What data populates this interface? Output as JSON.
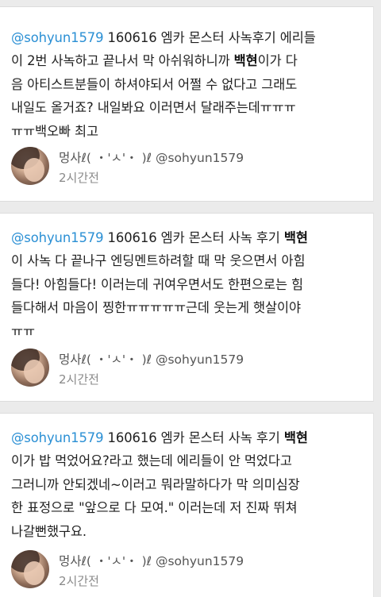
{
  "tweets": [
    {
      "lines": [
        {
          "parts": [
            {
              "t": "@sohyun1579",
              "s": "mention"
            },
            {
              "t": " 160616 엠카 몬스터 사녹후기 에리들",
              "s": "text"
            }
          ]
        },
        {
          "parts": [
            {
              "t": "이 2번 사녹하고 끝나서 막 아쉬워하니까 ",
              "s": "text"
            },
            {
              "t": "백현",
              "s": "bold"
            },
            {
              "t": "이가 다",
              "s": "text"
            }
          ]
        },
        {
          "parts": [
            {
              "t": "음 아티스트분들이 하셔야되서 어쩔 수 없다고 그래도",
              "s": "text"
            }
          ]
        },
        {
          "parts": [
            {
              "t": "내일도 올거죠? 내일봐요 이러면서 달래주는데ㅠㅠㅠ",
              "s": "text"
            }
          ]
        },
        {
          "parts": [
            {
              "t": "ㅠㅠ백오빠 최고",
              "s": "text"
            }
          ]
        }
      ],
      "user": "멍사ℓ( ・'ㅅ'・ )ℓ @sohyun1579",
      "time": "2시간전"
    },
    {
      "lines": [
        {
          "parts": [
            {
              "t": "@sohyun1579",
              "s": "mention"
            },
            {
              "t": " 160616 엠카 몬스터 사녹 후기 ",
              "s": "text"
            },
            {
              "t": "백현",
              "s": "bold"
            }
          ]
        },
        {
          "parts": [
            {
              "t": "이 사녹 다 끝나구 엔딩멘트하려할 때 막 웃으면서 아힘",
              "s": "text"
            }
          ]
        },
        {
          "parts": [
            {
              "t": "들다! 아힘들다! 이러는데 귀여우면서도 한편으로는 힘",
              "s": "text"
            }
          ]
        },
        {
          "parts": [
            {
              "t": "들다해서 마음이 찡한ㅠㅠㅠㅠㅠ근데 웃는게 햇살이야",
              "s": "text"
            }
          ]
        },
        {
          "parts": [
            {
              "t": "ㅠㅠ",
              "s": "text"
            }
          ]
        }
      ],
      "user": "멍사ℓ( ・'ㅅ'・ )ℓ @sohyun1579",
      "time": "2시간전"
    },
    {
      "lines": [
        {
          "parts": [
            {
              "t": "@sohyun1579",
              "s": "mention"
            },
            {
              "t": " 160616 엠카 몬스터 사녹 후기 ",
              "s": "text"
            },
            {
              "t": "백현",
              "s": "bold"
            }
          ]
        },
        {
          "parts": [
            {
              "t": "이가 밥 먹었어요?라고 했는데 에리들이 안 먹었다고",
              "s": "text"
            }
          ]
        },
        {
          "parts": [
            {
              "t": "그러니까 안되겠네~이러고 뭐라말하다가 막 의미심장",
              "s": "text"
            }
          ]
        },
        {
          "parts": [
            {
              "t": "한 표정으로 \"앞으로 다 모여.\" 이러는데 저 진짜 뛰쳐",
              "s": "text"
            }
          ]
        },
        {
          "parts": [
            {
              "t": "나갈뻔했구요.",
              "s": "text"
            }
          ]
        }
      ],
      "user": "멍사ℓ( ・'ㅅ'・ )ℓ @sohyun1579",
      "time": "2시간전"
    }
  ]
}
